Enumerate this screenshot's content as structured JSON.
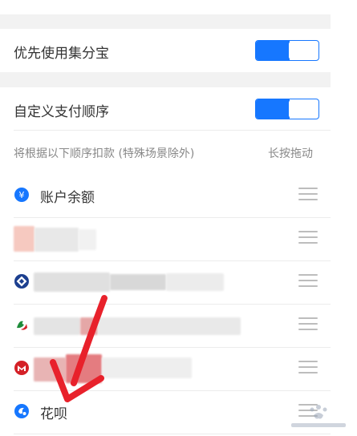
{
  "settings": {
    "prefer_jifenbao": {
      "label": "优先使用集分宝",
      "enabled": true
    },
    "custom_order": {
      "label": "自定义支付顺序",
      "enabled": true
    }
  },
  "order_hint": {
    "text": "将根据以下顺序扣款 (特殊场景除外)",
    "action": "长按拖动"
  },
  "payment_methods": [
    {
      "label": "账户余额",
      "icon": "yen-balance-icon"
    },
    {
      "label": "",
      "icon": "redacted-bank-icon"
    },
    {
      "label": "",
      "icon": "bank-diamond-icon"
    },
    {
      "label": "",
      "icon": "bank-green-icon"
    },
    {
      "label": "",
      "icon": "bank-red-icon"
    },
    {
      "label": "花呗",
      "icon": "huabei-icon"
    }
  ],
  "colors": {
    "accent": "#1677ff",
    "background_gap": "#f2f2f2",
    "arrow": "#e8212b"
  }
}
